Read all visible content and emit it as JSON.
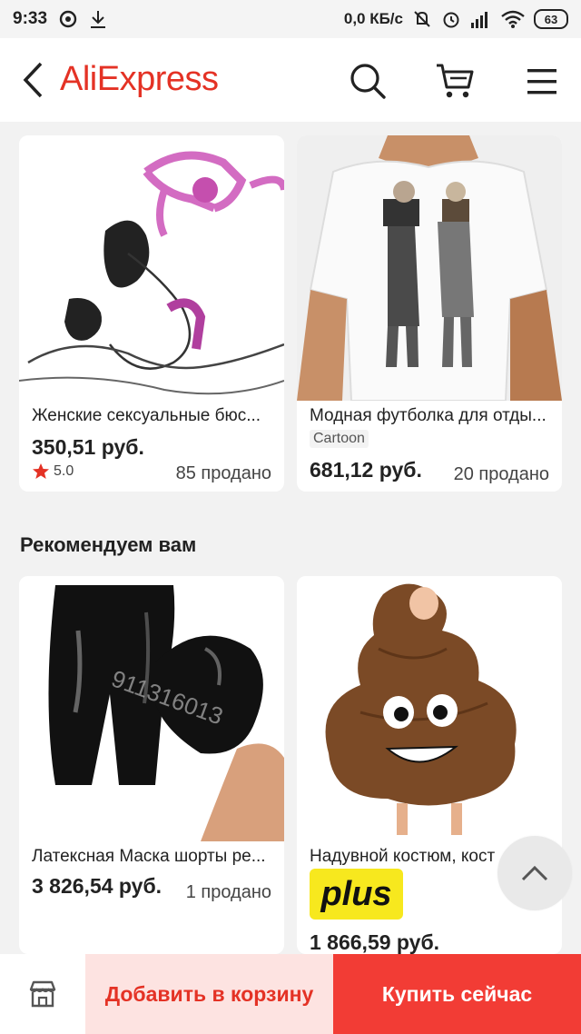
{
  "status_bar": {
    "time": "9:33",
    "network_speed": "0,0 КБ/с",
    "battery": "63",
    "icons": [
      "message-icon",
      "download-icon",
      "mute-icon",
      "alarm-icon",
      "signal-icon",
      "wifi-icon",
      "battery-icon"
    ]
  },
  "header": {
    "logo": "AliExpress",
    "brand_color": "#e43225",
    "icons": [
      "back-arrow-icon",
      "search-icon",
      "cart-icon",
      "menu-icon"
    ]
  },
  "products_top": [
    {
      "title": "Женские сексуальные бюс...",
      "price": "350,51 руб.",
      "rating": "5.0",
      "sold": "85 продано"
    },
    {
      "title": "Модная футболка для отды...",
      "tag": "Cartoon",
      "price": "681,12 руб.",
      "sold": "20 продано"
    }
  ],
  "recommend_section": {
    "title": "Рекомендуем вам",
    "products": [
      {
        "title": "Латексная Маска шорты ре...",
        "price": "3 826,54 руб.",
        "sold": "1 продано",
        "watermark": "911316013"
      },
      {
        "title": "Надувной костюм, кост",
        "badge": "plus",
        "price": "1 866,59 руб."
      }
    ]
  },
  "bottom_bar": {
    "store_icon": "store-icon",
    "add_to_cart": "Добавить в корзину",
    "buy_now": "Купить сейчас",
    "add_to_cart_bg": "#fde3e1",
    "buy_now_bg": "#f23c35"
  }
}
